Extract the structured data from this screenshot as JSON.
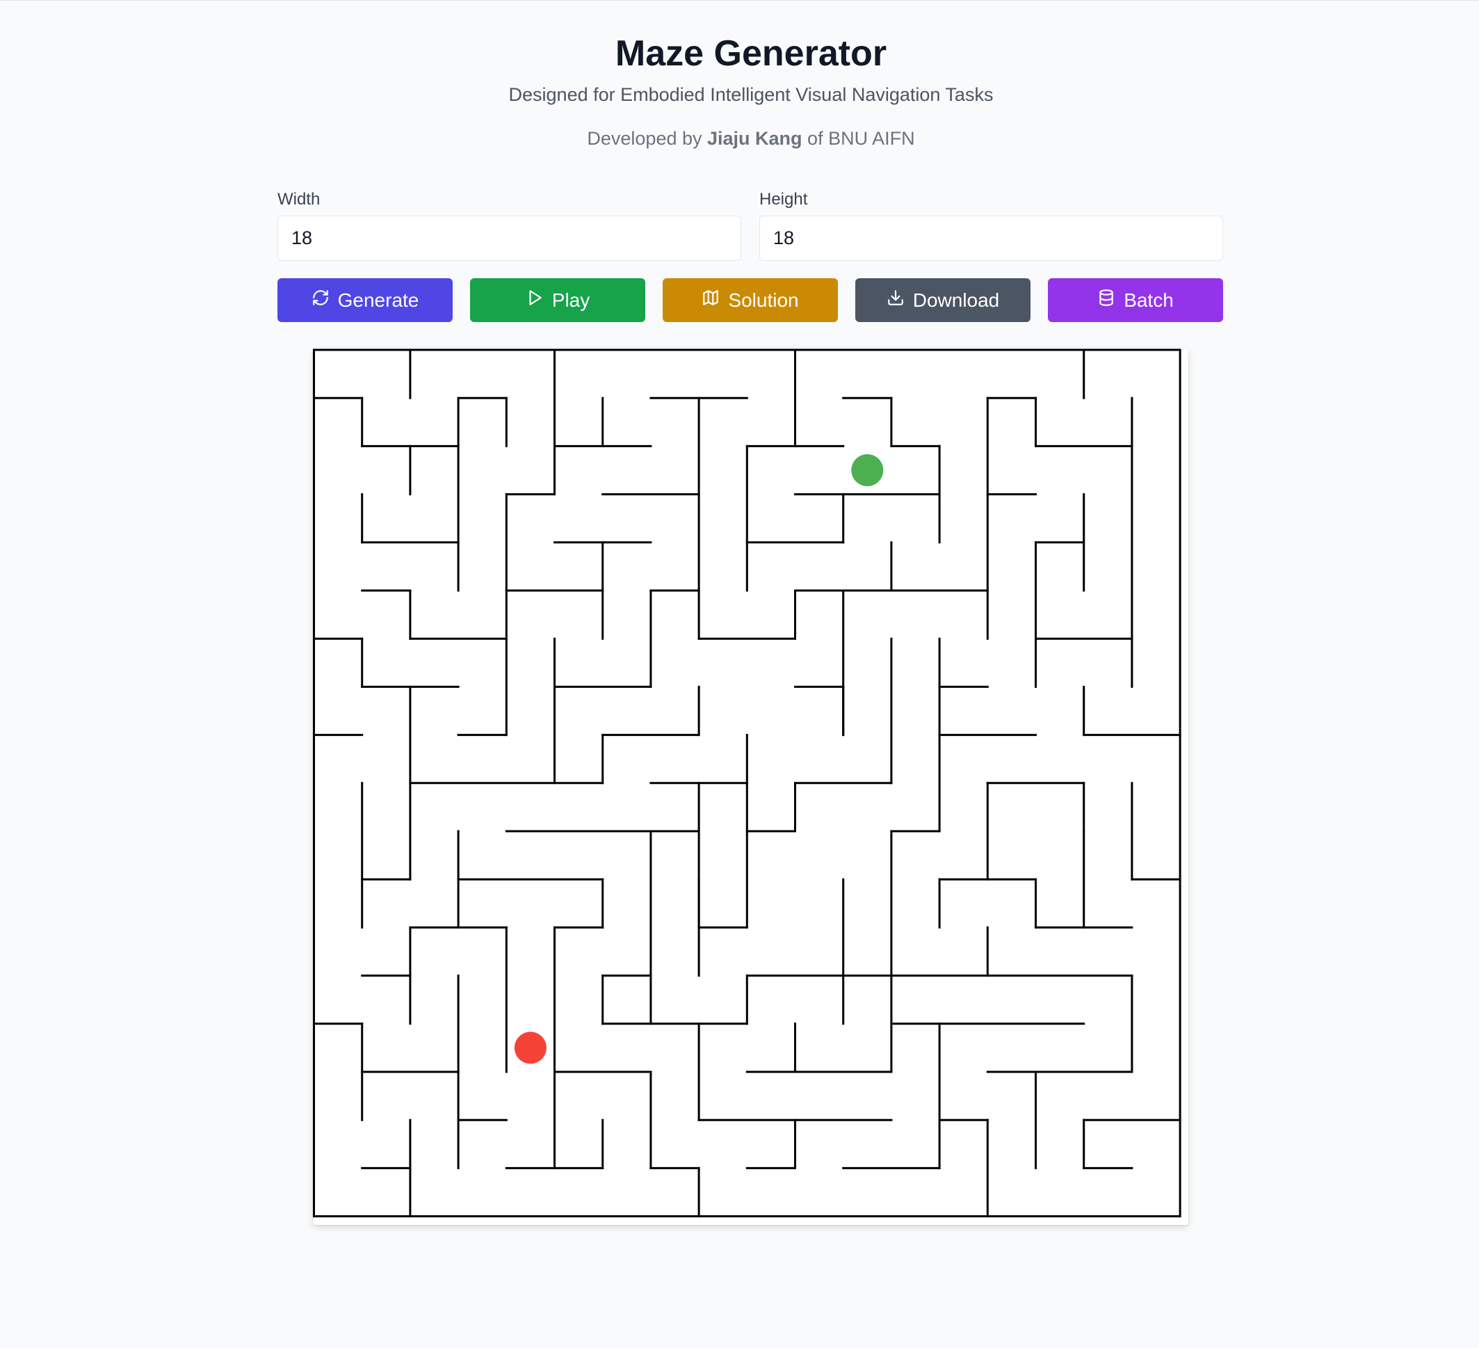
{
  "header": {
    "title": "Maze Generator",
    "subtitle": "Designed for Embodied Intelligent Visual Navigation Tasks",
    "credit_prefix": "Developed by ",
    "credit_name": "Jiaju Kang",
    "credit_suffix": " of BNU AIFN"
  },
  "controls": {
    "width_label": "Width",
    "width_value": "18",
    "height_label": "Height",
    "height_value": "18"
  },
  "buttons": [
    {
      "label": "Generate",
      "icon": "refresh-icon",
      "color": "#4f46e5"
    },
    {
      "label": "Play",
      "icon": "play-icon",
      "color": "#16a34a"
    },
    {
      "label": "Solution",
      "icon": "map-icon",
      "color": "#ca8a04"
    },
    {
      "label": "Download",
      "icon": "download-icon",
      "color": "#4b5563"
    },
    {
      "label": "Batch",
      "icon": "database-icon",
      "color": "#9333ea"
    }
  ],
  "maze": {
    "cols": 18,
    "rows": 18,
    "start": {
      "col": 11,
      "row": 2,
      "color": "#4caf50"
    },
    "goal": {
      "col": 4,
      "row": 14,
      "color": "#f44336"
    },
    "walls": [
      [
        0,
        0,
        18,
        0
      ],
      [
        0,
        18,
        18,
        18
      ],
      [
        0,
        0,
        0,
        18
      ],
      [
        18,
        0,
        18,
        18
      ],
      [
        0,
        1,
        1,
        1
      ],
      [
        1,
        1,
        1,
        2
      ],
      [
        1,
        2,
        3,
        2
      ],
      [
        2,
        0,
        2,
        1
      ],
      [
        2,
        2,
        2,
        3
      ],
      [
        3,
        1,
        4,
        1
      ],
      [
        3,
        1,
        3,
        5
      ],
      [
        4,
        1,
        4,
        2
      ],
      [
        5,
        0,
        5,
        3
      ],
      [
        5,
        2,
        7,
        2
      ],
      [
        6,
        1,
        6,
        2
      ],
      [
        7,
        1,
        9,
        1
      ],
      [
        8,
        1,
        8,
        6
      ],
      [
        4,
        3,
        5,
        3
      ],
      [
        4,
        3,
        4,
        8
      ],
      [
        6,
        3,
        8,
        3
      ],
      [
        10,
        0,
        10,
        2
      ],
      [
        9,
        2,
        10,
        2
      ],
      [
        10,
        2,
        11,
        2
      ],
      [
        9,
        2,
        9,
        5
      ],
      [
        11,
        1,
        12,
        1
      ],
      [
        12,
        1,
        12,
        2
      ],
      [
        12,
        2,
        13,
        2
      ],
      [
        13,
        2,
        13,
        4
      ],
      [
        10,
        3,
        13,
        3
      ],
      [
        11,
        3,
        11,
        4
      ],
      [
        9,
        4,
        11,
        4
      ],
      [
        12,
        4,
        12,
        5
      ],
      [
        14,
        1,
        15,
        1
      ],
      [
        15,
        1,
        15,
        2
      ],
      [
        15,
        2,
        17,
        2
      ],
      [
        14,
        1,
        14,
        6
      ],
      [
        14,
        3,
        15,
        3
      ],
      [
        16,
        0,
        16,
        1
      ],
      [
        17,
        1,
        17,
        7
      ],
      [
        1,
        3,
        1,
        4
      ],
      [
        1,
        4,
        3,
        4
      ],
      [
        5,
        4,
        7,
        4
      ],
      [
        6,
        4,
        6,
        6
      ],
      [
        15,
        4,
        16,
        4
      ],
      [
        16,
        3,
        16,
        5
      ],
      [
        15,
        4,
        15,
        7
      ],
      [
        1,
        5,
        2,
        5
      ],
      [
        2,
        5,
        2,
        6
      ],
      [
        2,
        6,
        4,
        6
      ],
      [
        4,
        5,
        6,
        5
      ],
      [
        7,
        5,
        8,
        5
      ],
      [
        7,
        5,
        7,
        7
      ],
      [
        10,
        5,
        14,
        5
      ],
      [
        10,
        5,
        10,
        6
      ],
      [
        8,
        6,
        10,
        6
      ],
      [
        11,
        5,
        11,
        8
      ],
      [
        0,
        6,
        1,
        6
      ],
      [
        1,
        6,
        1,
        7
      ],
      [
        1,
        7,
        3,
        7
      ],
      [
        5,
        6,
        5,
        9
      ],
      [
        5,
        7,
        7,
        7
      ],
      [
        12,
        6,
        12,
        9
      ],
      [
        13,
        6,
        13,
        10
      ],
      [
        15,
        6,
        17,
        6
      ],
      [
        2,
        7,
        2,
        11
      ],
      [
        3,
        8,
        4,
        8
      ],
      [
        6,
        8,
        8,
        8
      ],
      [
        8,
        7,
        8,
        8
      ],
      [
        6,
        8,
        6,
        9
      ],
      [
        10,
        7,
        11,
        7
      ],
      [
        11,
        7,
        11,
        8
      ],
      [
        13,
        7,
        14,
        7
      ],
      [
        16,
        7,
        16,
        8
      ],
      [
        13,
        8,
        15,
        8
      ],
      [
        16,
        8,
        18,
        8
      ],
      [
        0,
        8,
        1,
        8
      ],
      [
        2,
        9,
        6,
        9
      ],
      [
        7,
        9,
        9,
        9
      ],
      [
        9,
        8,
        9,
        12
      ],
      [
        10,
        9,
        10,
        10
      ],
      [
        10,
        9,
        12,
        9
      ],
      [
        1,
        9,
        1,
        12
      ],
      [
        4,
        10,
        8,
        10
      ],
      [
        8,
        9,
        8,
        13
      ],
      [
        7,
        10,
        7,
        14
      ],
      [
        9,
        10,
        10,
        10
      ],
      [
        12,
        10,
        13,
        10
      ],
      [
        12,
        10,
        12,
        13
      ],
      [
        14,
        9,
        16,
        9
      ],
      [
        16,
        9,
        16,
        10
      ],
      [
        14,
        9,
        14,
        11
      ],
      [
        17,
        9,
        17,
        11
      ],
      [
        17,
        11,
        18,
        11
      ],
      [
        1,
        11,
        2,
        11
      ],
      [
        3,
        10,
        3,
        12
      ],
      [
        3,
        11,
        6,
        11
      ],
      [
        6,
        11,
        6,
        12
      ],
      [
        8,
        11,
        8,
        12
      ],
      [
        8,
        12,
        9,
        12
      ],
      [
        11,
        11,
        11,
        14
      ],
      [
        13,
        11,
        13,
        12
      ],
      [
        13,
        11,
        15,
        11
      ],
      [
        15,
        11,
        15,
        12
      ],
      [
        16,
        10,
        16,
        12
      ],
      [
        15,
        12,
        17,
        12
      ],
      [
        14,
        12,
        14,
        13
      ],
      [
        2,
        12,
        2,
        14
      ],
      [
        2,
        12,
        4,
        12
      ],
      [
        4,
        12,
        4,
        15
      ],
      [
        5,
        12,
        6,
        12
      ],
      [
        5,
        12,
        5,
        17
      ],
      [
        1,
        13,
        2,
        13
      ],
      [
        3,
        13,
        3,
        17
      ],
      [
        6,
        13,
        7,
        13
      ],
      [
        6,
        13,
        6,
        14
      ],
      [
        6,
        14,
        9,
        14
      ],
      [
        9,
        13,
        17,
        13
      ],
      [
        9,
        13,
        9,
        14
      ],
      [
        12,
        13,
        12,
        14
      ],
      [
        17,
        13,
        17,
        15
      ],
      [
        0,
        14,
        1,
        14
      ],
      [
        1,
        14,
        1,
        16
      ],
      [
        12,
        14,
        16,
        14
      ],
      [
        12,
        14,
        12,
        15
      ],
      [
        8,
        14,
        8,
        16
      ],
      [
        10,
        14,
        10,
        15
      ],
      [
        1,
        15,
        3,
        15
      ],
      [
        5,
        15,
        7,
        15
      ],
      [
        7,
        15,
        7,
        17
      ],
      [
        9,
        15,
        12,
        15
      ],
      [
        13,
        14,
        13,
        17
      ],
      [
        14,
        15,
        17,
        15
      ],
      [
        15,
        15,
        15,
        17
      ],
      [
        8,
        16,
        12,
        16
      ],
      [
        3,
        16,
        4,
        16
      ],
      [
        2,
        16,
        2,
        18
      ],
      [
        6,
        16,
        6,
        17
      ],
      [
        10,
        16,
        10,
        17
      ],
      [
        13,
        16,
        14,
        16
      ],
      [
        14,
        16,
        14,
        18
      ],
      [
        16,
        16,
        18,
        16
      ],
      [
        16,
        16,
        16,
        17
      ],
      [
        16,
        17,
        17,
        17
      ],
      [
        1,
        17,
        2,
        17
      ],
      [
        4,
        17,
        6,
        17
      ],
      [
        7,
        17,
        8,
        17
      ],
      [
        8,
        17,
        8,
        18
      ],
      [
        9,
        17,
        10,
        17
      ],
      [
        11,
        17,
        13,
        17
      ]
    ]
  }
}
